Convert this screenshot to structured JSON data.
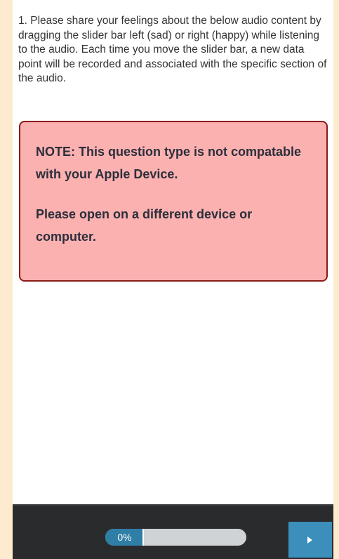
{
  "question": {
    "text": "1. Please share your feelings about the below audio content by dragging the slider bar left (sad) or right (happy) while listening to the audio. Each time you move the slider bar, a new data point will be recorded and associated with the specific section of the audio."
  },
  "note": {
    "line1": "NOTE: This question type is not compatable with your Apple Device.",
    "line2": "Please open on a different device or computer."
  },
  "footer": {
    "progress_label": "0%",
    "progress_value": 0,
    "next_icon": "play-triangle-icon"
  },
  "colors": {
    "page_background": "#fdebd0",
    "note_background": "#fcb1b1",
    "note_border": "#8b1a1a",
    "footer_background": "#2a2b2d",
    "accent": "#3b8fba"
  }
}
